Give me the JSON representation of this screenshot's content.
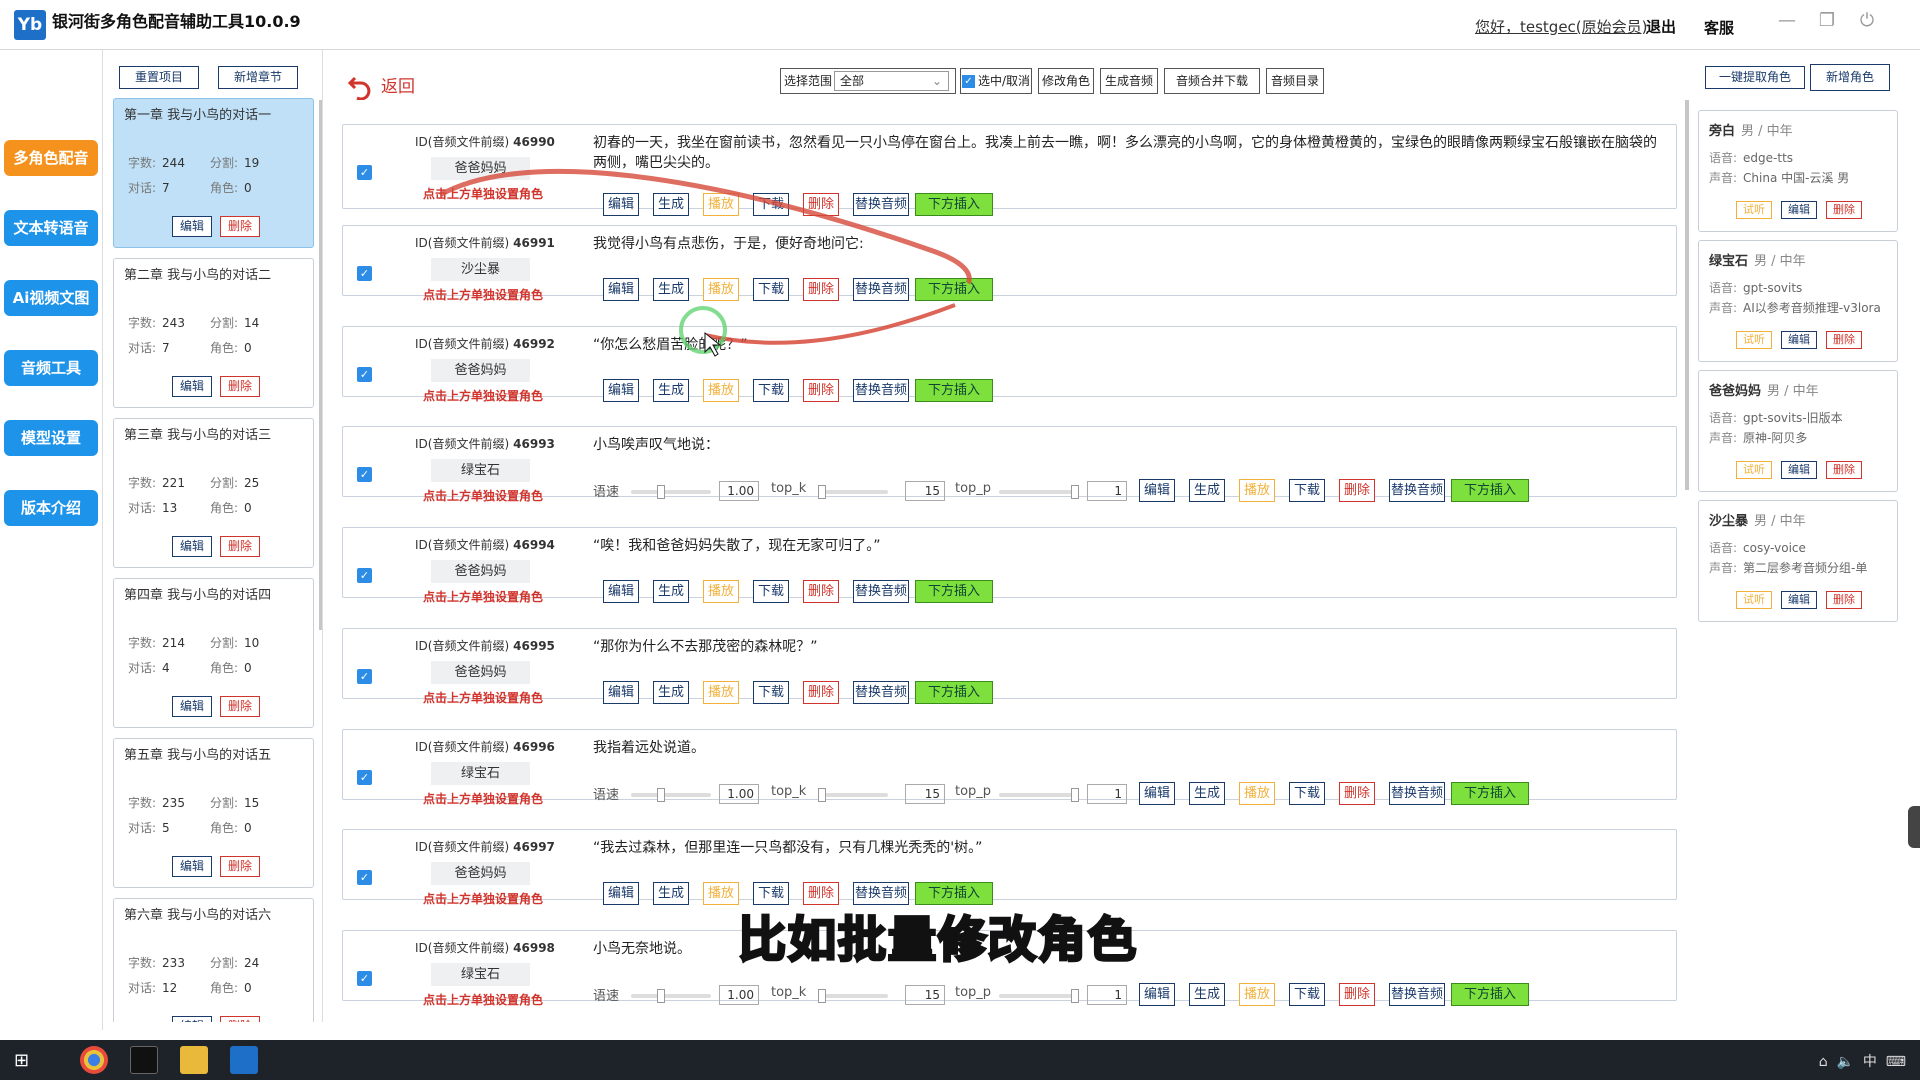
{
  "app": {
    "title": "银河街多角色配音辅助工具10.0.9",
    "logo_text": "Yb",
    "greeting": "您好，testgec(原始会员)",
    "logout": "退出",
    "service": "客服"
  },
  "nav": [
    "多角色配音",
    "文本转语音",
    "Ai视频文图",
    "音频工具",
    "模型设置",
    "版本介绍"
  ],
  "chapter_panel": {
    "reset": "重置项目",
    "add_chapter": "新增章节",
    "edit": "编辑",
    "delete": "删除",
    "label_words": "字数:",
    "label_split": "分割:",
    "label_dialog": "对话:",
    "label_role": "角色:",
    "chapters": [
      {
        "title": "第一章 我与小鸟的对话一",
        "words": "244",
        "split": "19",
        "dialog": "7",
        "role": "0"
      },
      {
        "title": "第二章 我与小鸟的对话二",
        "words": "243",
        "split": "14",
        "dialog": "7",
        "role": "0"
      },
      {
        "title": "第三章 我与小鸟的对话三",
        "words": "221",
        "split": "25",
        "dialog": "13",
        "role": "0"
      },
      {
        "title": "第四章 我与小鸟的对话四",
        "words": "214",
        "split": "10",
        "dialog": "4",
        "role": "0"
      },
      {
        "title": "第五章 我与小鸟的对话五",
        "words": "235",
        "split": "15",
        "dialog": "5",
        "role": "0"
      },
      {
        "title": "第六章 我与小鸟的对话六",
        "words": "233",
        "split": "24",
        "dialog": "12",
        "role": "0"
      }
    ]
  },
  "toolbar": {
    "back": "返回",
    "range_label": "选择范围",
    "range_value": "全部",
    "select_toggle": "选中/取消",
    "modify_role": "修改角色",
    "gen_audio": "生成音频",
    "merge_download": "音频合并下载",
    "audio_dir": "音频目录"
  },
  "row_labels": {
    "id_prefix": "ID(音频文件前缀)",
    "hint": "点击上方单独设置角色",
    "edit": "编辑",
    "gen": "生成",
    "play": "播放",
    "download": "下载",
    "delete": "删除",
    "replace": "替换音频",
    "insert": "下方插入",
    "speed": "语速",
    "topk": "top_k",
    "topp": "top_p"
  },
  "rows": [
    {
      "id": "46990",
      "role": "爸爸妈妈",
      "text": "初春的一天，我坐在窗前读书，忽然看见一只小鸟停在窗台上。我凑上前去一瞧，啊！多么漂亮的小鸟啊，它的身体橙黄橙黄的，宝绿色的眼睛像两颗绿宝石般镶嵌在脑袋的两侧，嘴巴尖尖的。",
      "params": false
    },
    {
      "id": "46991",
      "role": "沙尘暴",
      "text": "我觉得小鸟有点悲伤，于是，便好奇地问它:",
      "params": false
    },
    {
      "id": "46992",
      "role": "爸爸妈妈",
      "text": "“你怎么愁眉苦脸的呢？”",
      "params": false
    },
    {
      "id": "46993",
      "role": "绿宝石",
      "text": "小鸟唉声叹气地说：",
      "params": true,
      "speed": "1.00",
      "topk": "15",
      "topp": "1"
    },
    {
      "id": "46994",
      "role": "爸爸妈妈",
      "text": "“唉！我和爸爸妈妈失散了，现在无家可归了。”",
      "params": false
    },
    {
      "id": "46995",
      "role": "爸爸妈妈",
      "text": "“那你为什么不去那茂密的森林呢？”",
      "params": false
    },
    {
      "id": "46996",
      "role": "绿宝石",
      "text": "我指着远处说道。",
      "params": true,
      "speed": "1.00",
      "topk": "15",
      "topp": "1"
    },
    {
      "id": "46997",
      "role": "爸爸妈妈",
      "text": "“我去过森林，但那里连一只鸟都没有，只有几棵光秃秃的'树。”",
      "params": false
    },
    {
      "id": "46998",
      "role": "绿宝石",
      "text": "小鸟无奈地说。",
      "params": true,
      "speed": "1.00",
      "topk": "15",
      "topp": "1"
    }
  ],
  "right_panel": {
    "extract_roles": "一键提取角色",
    "add_role": "新增角色",
    "label_lang": "语音:",
    "label_voice": "声音:",
    "try": "试听",
    "edit": "编辑",
    "delete": "删除",
    "roles": [
      {
        "name": "旁白",
        "meta": "男 / 中年",
        "lang": "edge-tts",
        "voice": "China 中国-云溪 男"
      },
      {
        "name": "绿宝石",
        "meta": "男 / 中年",
        "lang": "gpt-sovits",
        "voice": "AI以参考音频推理-v3lora"
      },
      {
        "name": "爸爸妈妈",
        "meta": "男 / 中年",
        "lang": "gpt-sovits-旧版本",
        "voice": "原神-阿贝多"
      },
      {
        "name": "沙尘暴",
        "meta": "男 / 中年",
        "lang": "cosy-voice",
        "voice": "第二层参考音频分组-单"
      }
    ]
  },
  "caption": "比如批量修改角色",
  "tray": "中",
  "colors": {
    "nav_active": "#f4921d",
    "nav": "#1d93e9",
    "insert_btn": "#7de03d",
    "accent_red": "#d0342c",
    "caption": "#f2e21a"
  }
}
